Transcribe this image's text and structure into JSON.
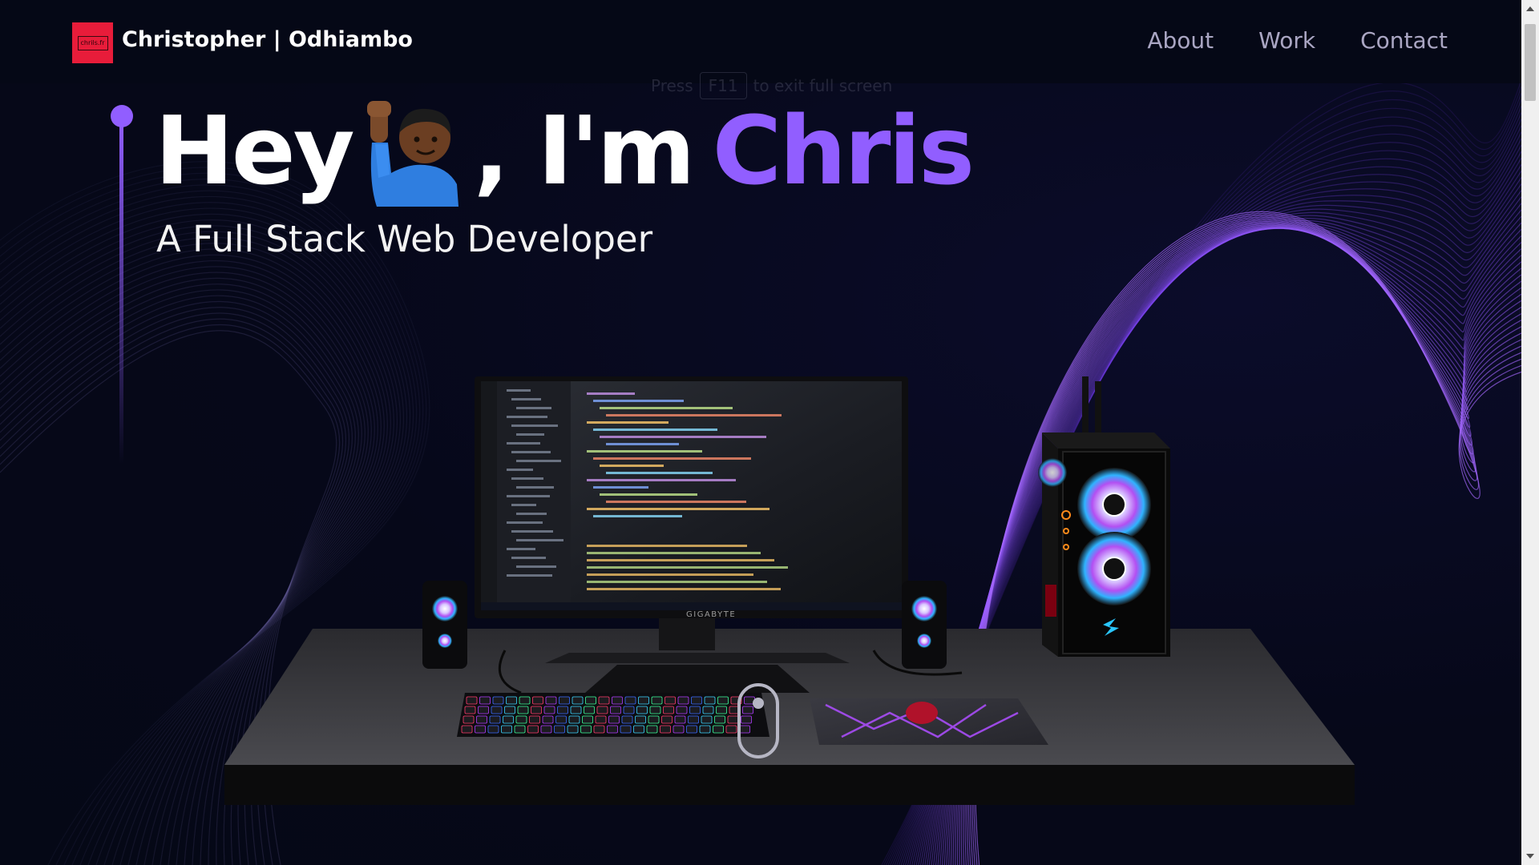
{
  "navbar": {
    "logo_text": "chrils.fr",
    "brand_name": "Christopher | Odhiambo",
    "links": [
      {
        "label": "About"
      },
      {
        "label": "Work"
      },
      {
        "label": "Contact"
      }
    ]
  },
  "fullscreen_hint": {
    "prefix": "Press",
    "key": "F11",
    "suffix": "to exit full screen"
  },
  "hero": {
    "greeting": "Hey",
    "emoji": "person-raising-hand-icon",
    "separator": ", I'm",
    "name": "Chris",
    "subtitle": "A Full Stack Web Developer"
  },
  "scene": {
    "monitor_brand": "GIGABYTE"
  },
  "colors": {
    "background": "#050816",
    "accent": "#915eff",
    "logo": "#e81c3a",
    "nav_text": "#aaa6c3"
  }
}
